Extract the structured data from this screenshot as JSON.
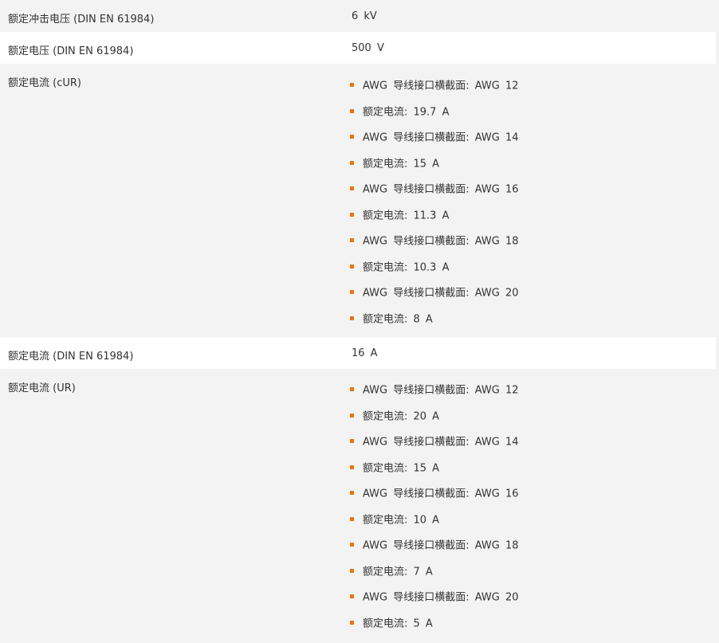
{
  "rows": [
    {
      "label": "额定冲击电压 (DIN EN 61984)",
      "value": "6 kV"
    },
    {
      "label": "额定电压 (DIN EN 61984)",
      "value": "500 V"
    },
    {
      "label": "额定电流 (cUR)",
      "items": [
        "AWG 导线接口横截面: AWG 12",
        "额定电流: 19.7 A",
        "AWG 导线接口横截面: AWG 14",
        "额定电流: 15 A",
        "AWG 导线接口横截面: AWG 16",
        "额定电流: 11.3 A",
        "AWG 导线接口横截面: AWG 18",
        "额定电流: 10.3 A",
        "AWG 导线接口横截面: AWG 20",
        "额定电流: 8 A"
      ]
    },
    {
      "label": "额定电流 (DIN EN 61984)",
      "value": "16 A"
    },
    {
      "label": "额定电流 (UR)",
      "items": [
        "AWG 导线接口横截面: AWG 12",
        "额定电流: 20 A",
        "AWG 导线接口横截面: AWG 14",
        "额定电流: 15 A",
        "AWG 导线接口横截面: AWG 16",
        "额定电流: 10 A",
        "AWG 导线接口横截面: AWG 18",
        "额定电流: 7 A",
        "AWG 导线接口横截面: AWG 20",
        "额定电流: 5 A"
      ]
    }
  ],
  "colors": {
    "bullet": "#e87511",
    "row_alt": "#ffffff",
    "row_base": "#f3f3f3",
    "text": "#333333"
  }
}
